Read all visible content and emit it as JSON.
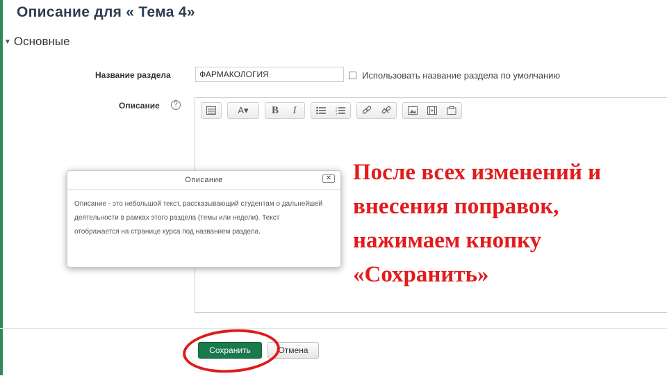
{
  "page": {
    "title": "Описание для « Тема 4»",
    "section_header": "Основные"
  },
  "form": {
    "section_name_label": "Название раздела",
    "section_name_value": "ФАРМАКОЛОГИЯ",
    "use_default_label": "Использовать название раздела по умолчанию",
    "description_label": "Описание",
    "help_icon_glyph": "?"
  },
  "editor_toolbar": {
    "groups": [
      [
        "toggle-toolbar-icon"
      ],
      [
        "font-style-icon"
      ],
      [
        "bold-icon",
        "italic-icon"
      ],
      [
        "bullet-list-icon",
        "numbered-list-icon"
      ],
      [
        "link-icon",
        "unlink-icon"
      ],
      [
        "image-icon",
        "media-icon",
        "manage-files-icon"
      ]
    ],
    "bold_glyph": "B",
    "italic_glyph": "I",
    "font_glyph": "A▾"
  },
  "help_dialog": {
    "title": "Описание",
    "close_glyph": "✕",
    "body": "Описание - это небольшой текст, рассказывающий студентам о дальнейшей деятельности в рамках этого раздела (темы или недели). Текст отображается на странице курса под названием раздела."
  },
  "buttons": {
    "save_label": "Сохранить",
    "cancel_label": "Отмена"
  },
  "annotation": {
    "text": "После всех изменений и внесения поправок, нажимаем кнопку «Сохранить»",
    "color": "#e31b1b"
  },
  "colors": {
    "accent_bar": "#2e8b57",
    "save_button": "#1a7a4c",
    "highlight_ellipse": "#e01b1b"
  }
}
